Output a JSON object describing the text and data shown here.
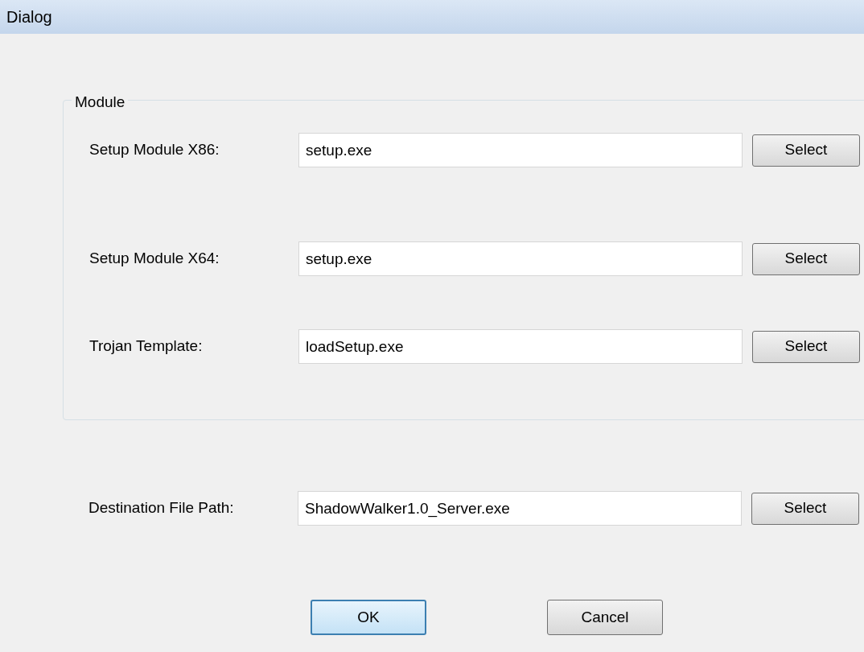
{
  "window": {
    "title": "Dialog"
  },
  "module_group": {
    "legend": "Module",
    "rows": [
      {
        "label": "Setup Module X86:",
        "value": "setup.exe",
        "button": "Select"
      },
      {
        "label": "Setup Module X64:",
        "value": "setup.exe",
        "button": "Select"
      },
      {
        "label": "Trojan Template:",
        "value": "loadSetup.exe",
        "button": "Select"
      }
    ]
  },
  "destination": {
    "label": "Destination File Path:",
    "value": "ShadowWalker1.0_Server.exe",
    "button": "Select"
  },
  "buttons": [
    {
      "label": "OK",
      "default": true
    },
    {
      "label": "Cancel",
      "default": false
    }
  ]
}
